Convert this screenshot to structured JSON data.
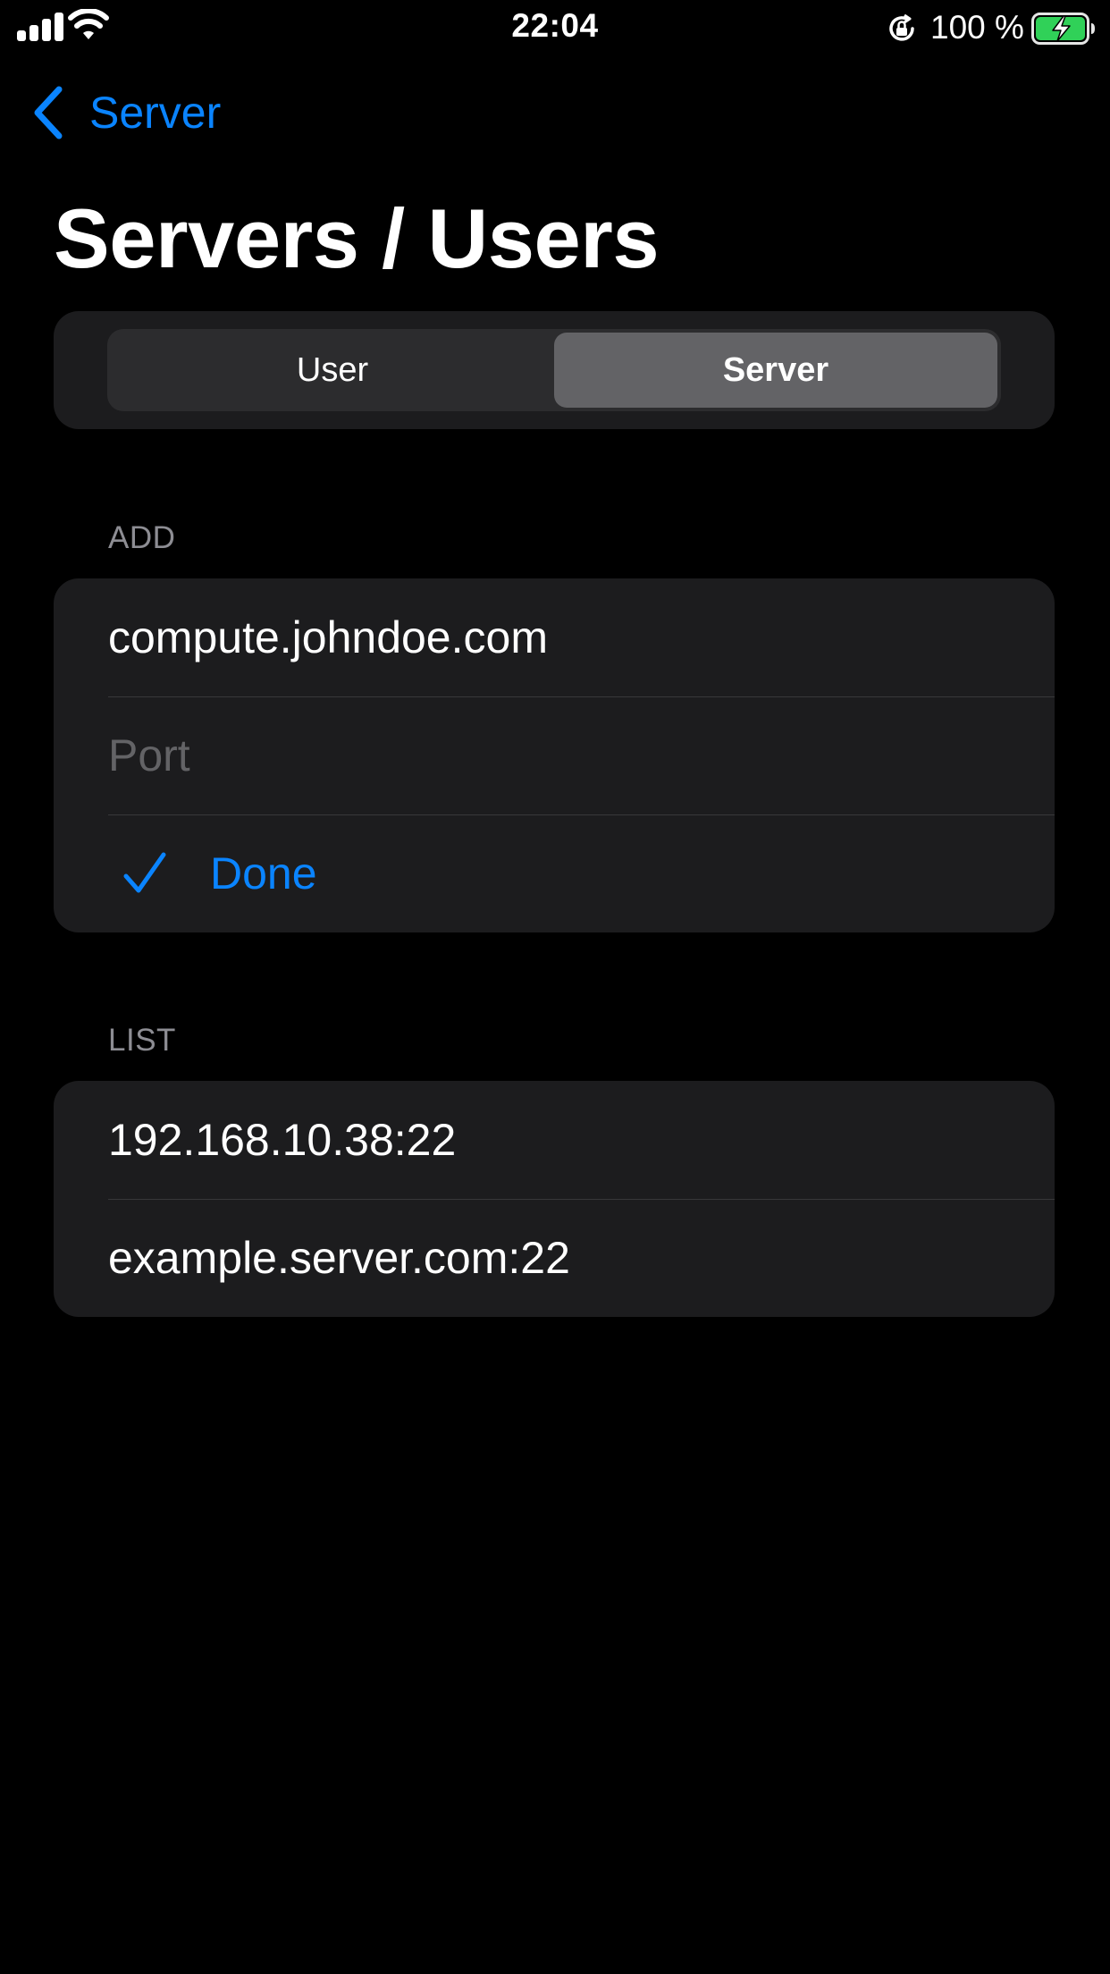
{
  "status_bar": {
    "time": "22:04",
    "battery_percent": "100 %",
    "battery_level": 1.0,
    "signal_bars": 4
  },
  "nav": {
    "back_label": "Server"
  },
  "page": {
    "title": "Servers / Users"
  },
  "segmented": {
    "options": [
      "User",
      "Server"
    ],
    "selected": "Server"
  },
  "add_section": {
    "header": "ADD",
    "host_value": "compute.johndoe.com",
    "port_placeholder": "Port",
    "done_label": "Done"
  },
  "list_section": {
    "header": "LIST",
    "items": [
      "192.168.10.38:22",
      "example.server.com:22"
    ]
  },
  "colors": {
    "accent": "#0a84ff",
    "background": "#000000",
    "card": "#1c1c1e",
    "battery_fill": "#30d158"
  },
  "icons": {
    "status": [
      "signal-icon",
      "wifi-icon",
      "rotation-lock-icon",
      "battery-charging-icon"
    ],
    "nav": "chevron-left-icon",
    "done": "checkmark-icon"
  }
}
